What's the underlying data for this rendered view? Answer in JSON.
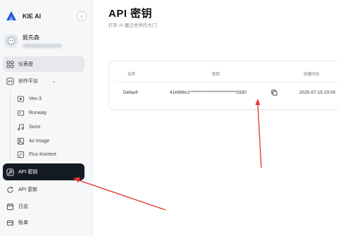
{
  "colors": {
    "accent": "#1e5ad7",
    "active_bg": "#151b24",
    "arrow": "#e53935"
  },
  "brand": {
    "name": "KIE AI"
  },
  "user": {
    "name": "姬先森"
  },
  "nav": {
    "dashboard": "仪表盘",
    "platform": "创作平台",
    "platform_items": [
      "Veo 3",
      "Runway",
      "Suno",
      "4o Image",
      "Flux Kontext"
    ],
    "api_keys": "API 密钥",
    "api_updates": "API 更新",
    "logs": "日志",
    "billing": "账单"
  },
  "page": {
    "title": "API 密钥",
    "subtitle": "打开 AI 魔法世界的大门"
  },
  "table": {
    "headers": {
      "name": "名称",
      "key": "密钥",
      "created": "创建时间"
    },
    "rows": [
      {
        "name": "Default",
        "key": "41b966c1**************************0330",
        "created": "2025-07-15 23:00"
      }
    ]
  }
}
